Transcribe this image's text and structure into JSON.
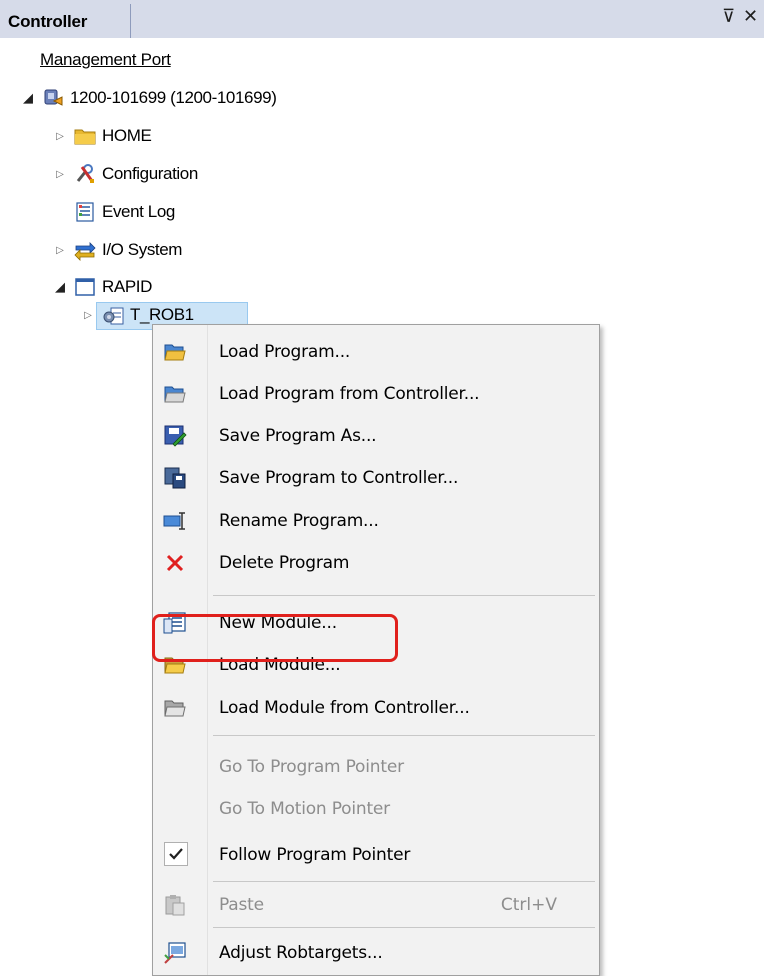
{
  "panel": {
    "title": "Controller",
    "pin_glyph": "⊽",
    "close_glyph": "✕"
  },
  "tree": {
    "management_port": "Management Port",
    "controller_label": "1200-101699 (1200-101699)",
    "nodes": [
      {
        "label": "HOME",
        "icon": "folder-icon"
      },
      {
        "label": "Configuration",
        "icon": "tools-icon"
      },
      {
        "label": "Event Log",
        "icon": "event-log-icon"
      },
      {
        "label": "I/O System",
        "icon": "io-system-icon"
      },
      {
        "label": "RAPID",
        "icon": "window-icon"
      },
      {
        "label": "T_ROB1",
        "icon": "task-icon"
      }
    ]
  },
  "menu": {
    "items": [
      {
        "label": "Load Program...",
        "icon": "open-folder-icon"
      },
      {
        "label": "Load Program from Controller...",
        "icon": "open-folder-gray-icon"
      },
      {
        "label": "Save Program As...",
        "icon": "save-as-icon"
      },
      {
        "label": "Save Program to Controller...",
        "icon": "save-controller-icon"
      },
      {
        "label": "Rename Program...",
        "icon": "rename-icon"
      },
      {
        "label": "Delete Program",
        "icon": "delete-x-icon"
      },
      {
        "label": "New Module...",
        "icon": "new-module-icon"
      },
      {
        "label": "Load Module...",
        "icon": "open-folder-icon"
      },
      {
        "label": "Load Module from Controller...",
        "icon": "open-folder-gray-icon"
      },
      {
        "label": "Go To Program Pointer",
        "disabled": true
      },
      {
        "label": "Go To Motion Pointer",
        "disabled": true
      },
      {
        "label": "Follow Program Pointer",
        "icon": "checkmark-icon",
        "checked": true
      },
      {
        "label": "Paste",
        "icon": "paste-icon",
        "shortcut": "Ctrl+V",
        "disabled": true
      },
      {
        "label": "Adjust Robtargets...",
        "icon": "adjust-robtargets-icon"
      }
    ]
  },
  "colors": {
    "header_bg": "#d6dbe9",
    "selection_bg": "#cce4f7",
    "highlight_border": "#e0201c",
    "menu_bg": "#f2f2f2"
  }
}
